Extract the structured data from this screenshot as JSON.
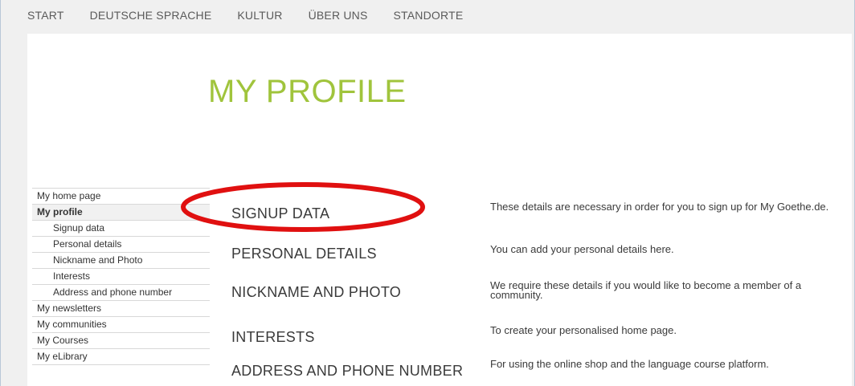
{
  "topnav": {
    "items": [
      "START",
      "DEUTSCHE SPRACHE",
      "KULTUR",
      "ÜBER UNS",
      "STANDORTE"
    ]
  },
  "page": {
    "title": "MY PROFILE"
  },
  "sidebar": {
    "items": [
      {
        "label": "My home page"
      },
      {
        "label": "My profile"
      },
      {
        "label": "Signup data"
      },
      {
        "label": "Personal details"
      },
      {
        "label": "Nickname and Photo"
      },
      {
        "label": "Interests"
      },
      {
        "label": "Address and phone number"
      },
      {
        "label": "My newsletters"
      },
      {
        "label": "My communities"
      },
      {
        "label": "My Courses"
      },
      {
        "label": "My eLibrary"
      }
    ]
  },
  "sections": [
    {
      "title": "SIGNUP DATA",
      "desc": "These details are necessary in order for you to sign up for My Goethe.de."
    },
    {
      "title": "PERSONAL DETAILS",
      "desc": "You can add your personal details here."
    },
    {
      "title": "NICKNAME AND PHOTO",
      "desc": "We require these details if you would like to become a member of a community."
    },
    {
      "title": "INTERESTS",
      "desc": "To create your personalised home page."
    },
    {
      "title": "ADDRESS AND PHONE NUMBER",
      "desc": "For using the online shop and the language course platform."
    }
  ],
  "colors": {
    "accent": "#a0c43c",
    "highlight": "#e01010"
  }
}
